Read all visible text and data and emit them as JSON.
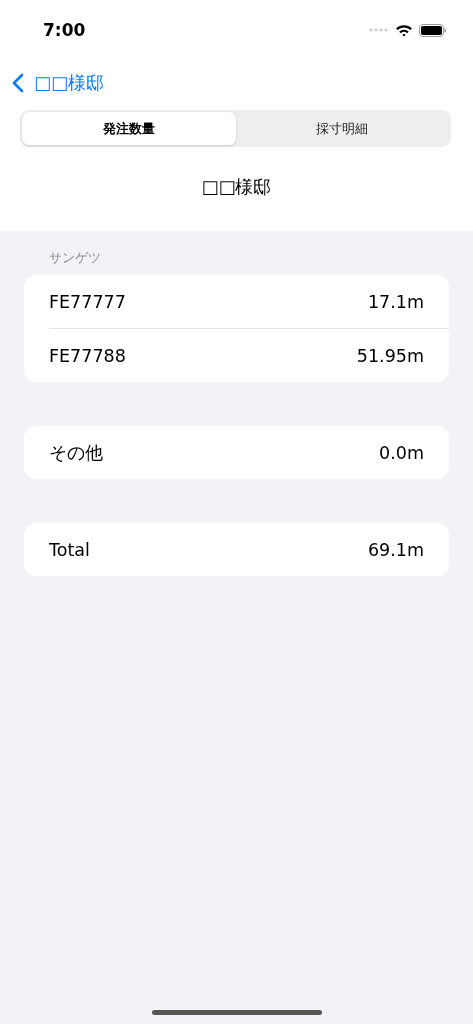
{
  "status_bar": {
    "time": "7:00"
  },
  "nav": {
    "back_label": "□□様邸"
  },
  "segments": [
    {
      "label": "発注数量",
      "selected": true
    },
    {
      "label": "採寸明細",
      "selected": false
    }
  ],
  "title": "□□様邸",
  "sections": [
    {
      "header": "サンゲツ",
      "rows": [
        {
          "label": "FE77777",
          "value": "17.1m"
        },
        {
          "label": "FE77788",
          "value": "51.95m"
        }
      ]
    },
    {
      "rows": [
        {
          "label": "その他",
          "value": "0.0m"
        }
      ]
    },
    {
      "rows": [
        {
          "label": "Total",
          "value": "69.1m"
        }
      ]
    }
  ]
}
